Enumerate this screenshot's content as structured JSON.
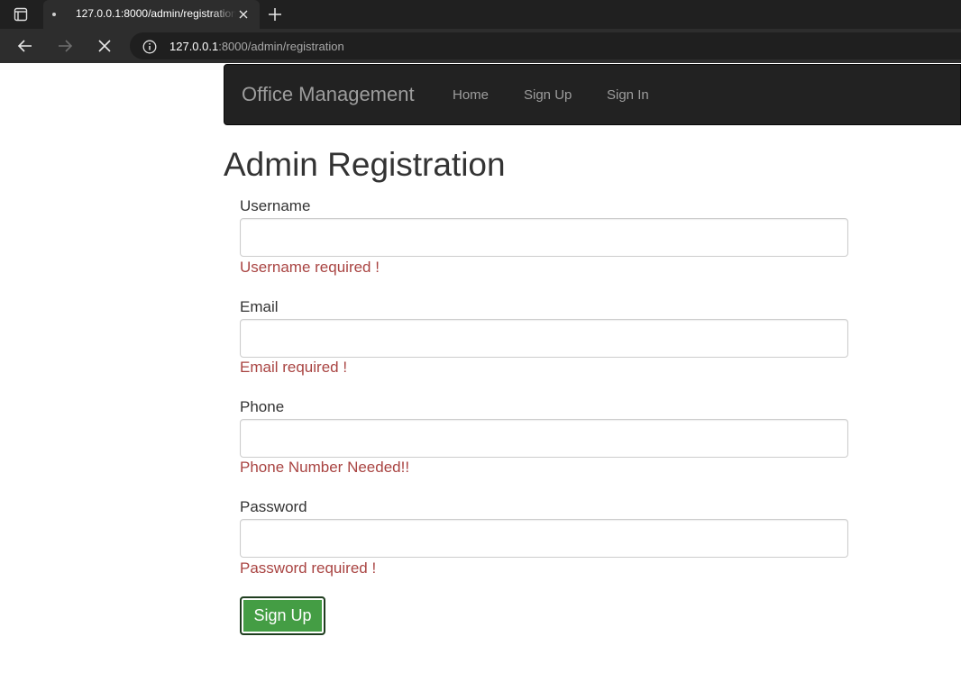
{
  "browser": {
    "tab": {
      "title": "127.0.0.1:8000/admin/registration"
    },
    "address_bar": {
      "host": "127.0.0.1",
      "rest": ":8000/admin/registration"
    }
  },
  "navbar": {
    "brand": "Office Management",
    "links": [
      {
        "label": "Home"
      },
      {
        "label": "Sign Up"
      },
      {
        "label": "Sign In"
      }
    ]
  },
  "page": {
    "title": "Admin Registration"
  },
  "form": {
    "fields": [
      {
        "label": "Username",
        "value": "",
        "error": "Username required !"
      },
      {
        "label": "Email",
        "value": "",
        "error": "Email required !"
      },
      {
        "label": "Phone",
        "value": "",
        "error": "Phone Number Needed!!"
      },
      {
        "label": "Password",
        "value": "",
        "error": "Password required !"
      }
    ],
    "submit_label": "Sign Up"
  },
  "colors": {
    "error_text": "#a94442",
    "success_button": "#449d44",
    "navbar_bg": "#222222"
  }
}
